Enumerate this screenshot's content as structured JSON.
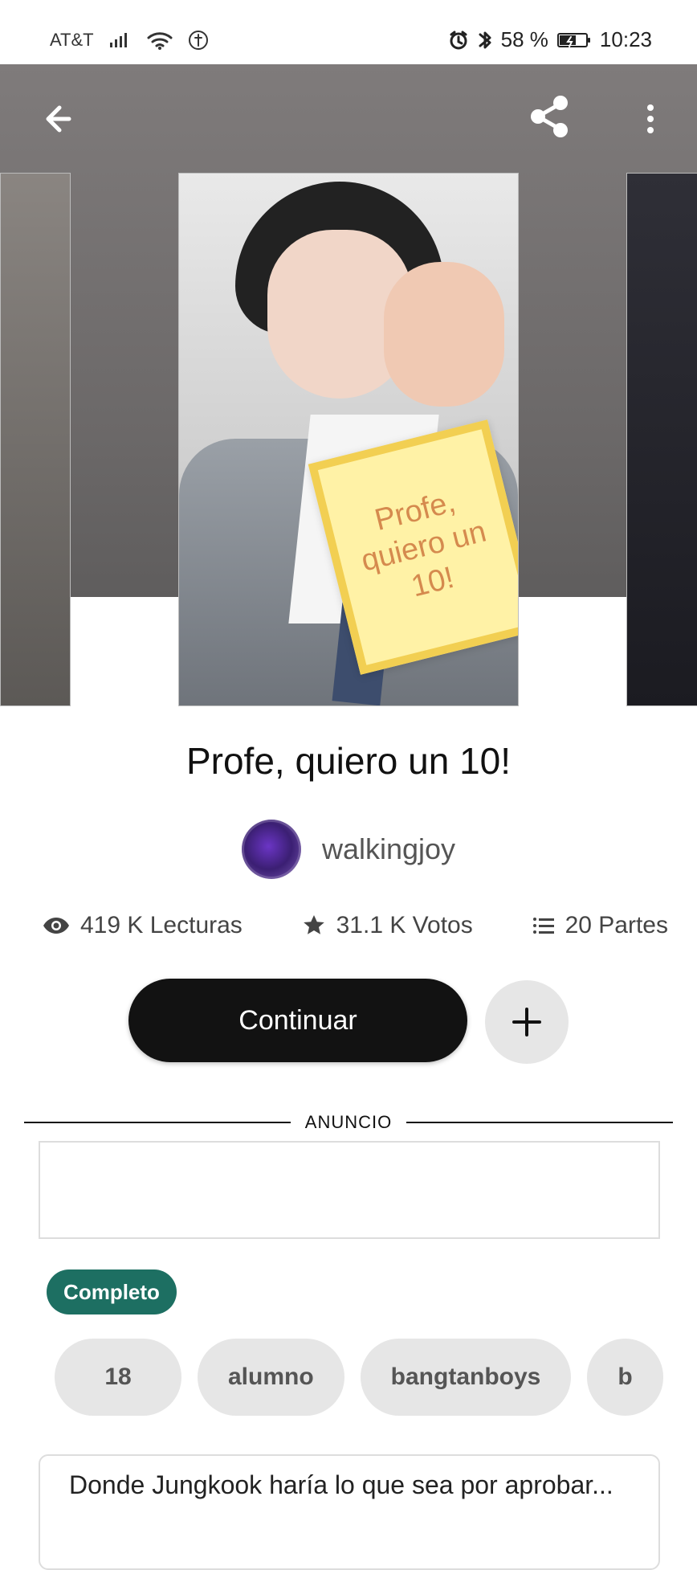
{
  "status_bar": {
    "carrier": "AT&T",
    "battery": "58 %",
    "time": "10:23"
  },
  "toolbar": {
    "back": "Back",
    "share": "Share",
    "more": "More"
  },
  "story": {
    "cover_note_text": "Profe, quiero un 10!",
    "title": "Profe, quiero un 10!",
    "author": "walkingjoy",
    "stats": {
      "reads": "419 K Lecturas",
      "votes": "31.1 K Votos",
      "parts": "20 Partes"
    },
    "primary_action": "Continuar",
    "ad_label": "ANUNCIO",
    "status": "Completo",
    "tags": [
      "18",
      "alumno",
      "bangtanboys",
      "b"
    ],
    "description_preview": "Donde Jungkook haría lo que sea por aprobar..."
  },
  "icons": {
    "back": "arrow-left-icon",
    "share": "share-icon",
    "more": "vertical-dots-icon",
    "reads": "eye-icon",
    "votes": "star-icon",
    "parts": "list-icon",
    "add": "plus-icon",
    "alarm": "alarm-icon",
    "bluetooth": "bluetooth-icon"
  }
}
